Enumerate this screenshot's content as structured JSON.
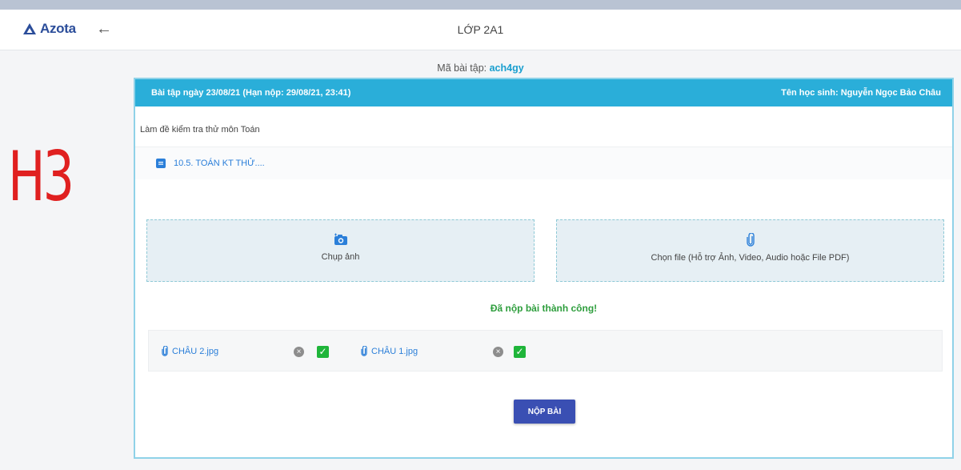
{
  "app": {
    "brand": "Azota",
    "page_title": "LỚP 2A1"
  },
  "annotation": "H3",
  "assignment": {
    "code_label": "Mã bài tập:",
    "code": "ach4gy",
    "header_left": "Bài tập ngày 23/08/21 (Hạn nộp: 29/08/21, 23:41)",
    "header_right": "Tên học sinh: Nguyễn Ngọc Bảo Châu",
    "description": "Làm đề kiểm tra thử môn Toán",
    "attachment": "10.5. TOÁN KT THỬ...."
  },
  "upload": {
    "photo_label": "Chụp ảnh",
    "file_label": "Chọn file (Hỗ trợ Ảnh, Video, Audio hoặc File PDF)"
  },
  "status": {
    "success": "Đã nộp bài thành công!"
  },
  "submitted_files": [
    {
      "name": "CHÂU 2.jpg"
    },
    {
      "name": "CHÂU 1.jpg"
    }
  ],
  "actions": {
    "submit": "NỘP BÀI"
  },
  "colors": {
    "brand": "#2b4d9a",
    "header_bar": "#2aaed9",
    "link": "#2b7fd9",
    "success": "#2e9e3d",
    "submit_button": "#3a4fb3",
    "annotation": "#e02020"
  }
}
